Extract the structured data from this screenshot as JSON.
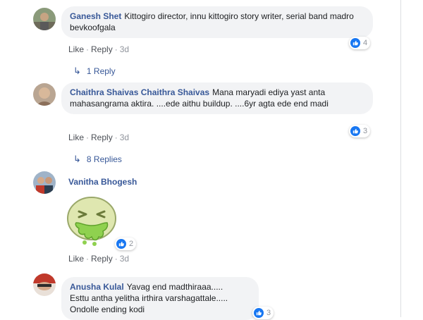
{
  "comments": [
    {
      "author": "Ganesh Shet",
      "text": "Kittogiro director, innu kittogiro story writer, serial band madro bevkoofgala",
      "actions": {
        "like": "Like",
        "reply": "Reply",
        "time": "3d"
      },
      "reactions": "4",
      "replies_label": "1 Reply"
    },
    {
      "author": "Chaithra Shaivas Chaithra Shaivas",
      "text": "Mana maryadi ediya yast anta mahasangrama aktira. ....ede aithu buildup. ....6yr agta ede end madi",
      "actions": {
        "like": "Like",
        "reply": "Reply",
        "time": "3d"
      },
      "reactions": "3",
      "replies_label": "8 Replies"
    },
    {
      "author": "Vanitha Bhogesh",
      "text": "",
      "sticker": "sick-face-sticker",
      "actions": {
        "like": "Like",
        "reply": "Reply",
        "time": "3d"
      },
      "reactions": "2"
    },
    {
      "author": "Anusha Kulal",
      "text_lines": [
        "Yavag end madthiraaa.....",
        "Esttu antha yelitha irthira varshagattale.....",
        "Ondolle ending kodi"
      ],
      "reactions": "3"
    }
  ],
  "colors": {
    "name": "#385898",
    "bubble": "#f2f3f5",
    "like": "#1877f2",
    "meta": "#90949c"
  },
  "icons": {
    "reply": "reply-arrow-icon",
    "like": "thumbs-up-icon"
  }
}
